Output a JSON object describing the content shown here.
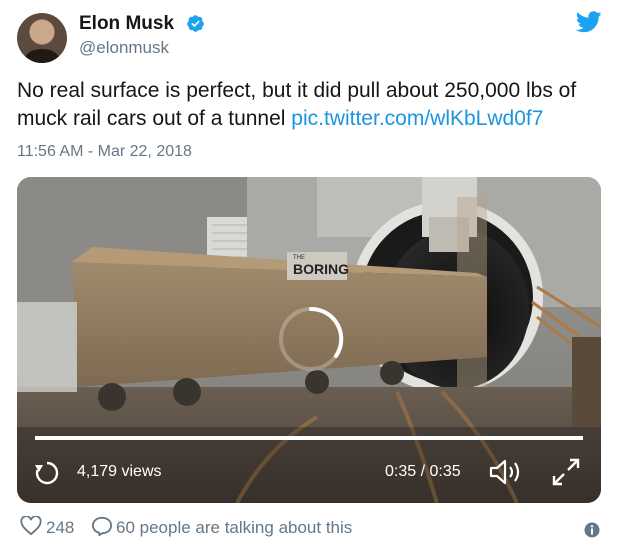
{
  "author": {
    "name": "Elon Musk",
    "handle": "@elonmusk"
  },
  "tweet": {
    "text": "No real surface is perfect, but it did pull about 250,000 lbs of muck rail cars out of a tunnel ",
    "link": "pic.twitter.com/wlKbLwd0f7",
    "timestamp": "11:56 AM - Mar 22, 2018"
  },
  "video": {
    "scene_sign_line1": "THE",
    "scene_sign_line2": "BORING",
    "views": "4,179 views",
    "time": "0:35 / 0:35",
    "progress": 1.0
  },
  "footer": {
    "likes": "248",
    "talking": "60 people are talking about this"
  },
  "icons": {
    "verified": "verified-badge-icon",
    "brand": "twitter-bird-icon",
    "replay": "replay-icon",
    "volume": "volume-icon",
    "fullscreen": "fullscreen-icon",
    "like": "heart-icon",
    "reply": "speech-bubble-icon",
    "info": "info-icon"
  },
  "colors": {
    "twitter_blue": "#1da1f2",
    "link": "#1b95e0",
    "muted": "#657786",
    "text": "#14171a"
  }
}
